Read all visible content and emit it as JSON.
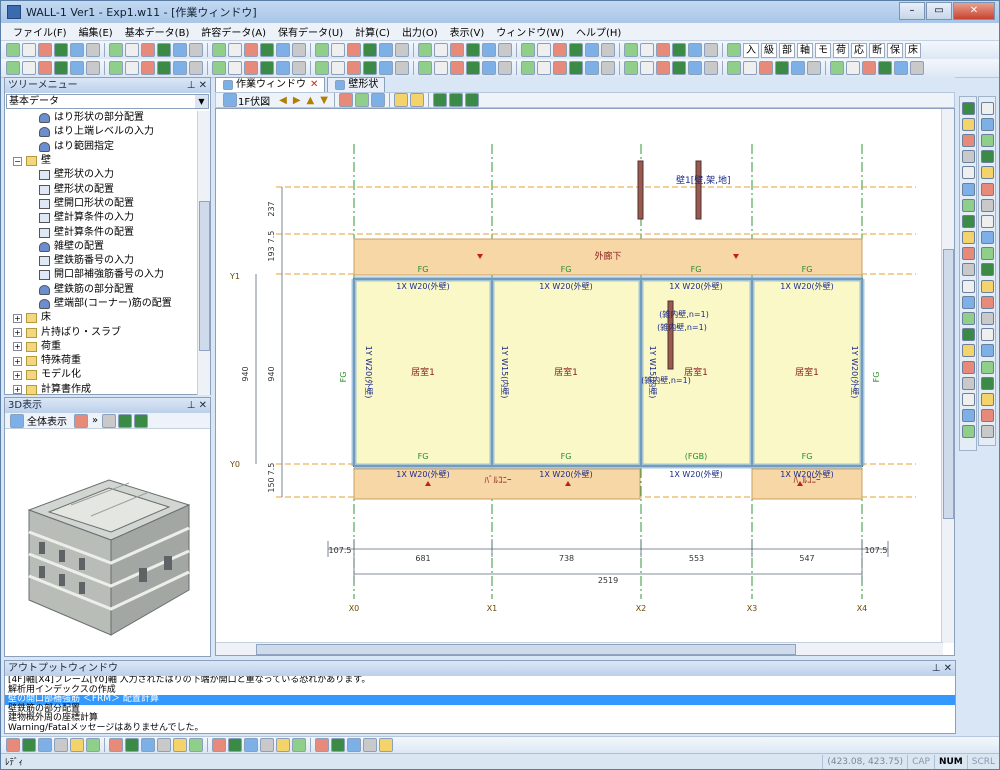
{
  "window": {
    "title": "WALL-1 Ver1 - Exp1.w11 - [作業ウィンドウ]",
    "min": "–",
    "max": "▭",
    "close": "✕"
  },
  "menu": [
    "ファイル(F)",
    "編集(E)",
    "基本データ(B)",
    "許容データ(A)",
    "保有データ(U)",
    "計算(C)",
    "出力(O)",
    "表示(V)",
    "ウィンドウ(W)",
    "ヘルプ(H)"
  ],
  "toolbar_text": [
    "入",
    "級",
    "部",
    "軸",
    "モ",
    "荷",
    "応",
    "断",
    "保",
    "床"
  ],
  "tree": {
    "header": "ツリーメニュー",
    "combo": "基本データ",
    "items": [
      {
        "label": "はり形状の部分配置",
        "icon": "leaf",
        "indent": 2
      },
      {
        "label": "はり上端レベルの入力",
        "icon": "leaf",
        "indent": 2
      },
      {
        "label": "はり範囲指定",
        "icon": "leaf",
        "indent": 2
      },
      {
        "label": "壁",
        "icon": "folder",
        "indent": 0,
        "exp": "−"
      },
      {
        "label": "壁形状の入力",
        "icon": "doc",
        "indent": 2
      },
      {
        "label": "壁形状の配置",
        "icon": "doc",
        "indent": 2
      },
      {
        "label": "壁開口形状の配置",
        "icon": "doc",
        "indent": 2
      },
      {
        "label": "壁計算条件の入力",
        "icon": "doc",
        "indent": 2
      },
      {
        "label": "壁計算条件の配置",
        "icon": "doc",
        "indent": 2
      },
      {
        "label": "雑壁の配置",
        "icon": "leaf",
        "indent": 2
      },
      {
        "label": "壁鉄筋番号の入力",
        "icon": "doc",
        "indent": 2
      },
      {
        "label": "開口部補強筋番号の入力",
        "icon": "doc",
        "indent": 2
      },
      {
        "label": "壁鉄筋の部分配置",
        "icon": "leaf",
        "indent": 2
      },
      {
        "label": "壁端部(コーナー)筋の配置",
        "icon": "leaf",
        "indent": 2
      },
      {
        "label": "床",
        "icon": "folder",
        "indent": 0,
        "exp": "+"
      },
      {
        "label": "片持ばり・スラブ",
        "icon": "folder",
        "indent": 0,
        "exp": "+"
      },
      {
        "label": "荷重",
        "icon": "folder",
        "indent": 0,
        "exp": "+"
      },
      {
        "label": "特殊荷重",
        "icon": "folder",
        "indent": 0,
        "exp": "+"
      },
      {
        "label": "モデル化",
        "icon": "folder",
        "indent": 0,
        "exp": "+"
      },
      {
        "label": "計算書作成",
        "icon": "folder",
        "indent": 0,
        "exp": "+"
      }
    ]
  },
  "view3d": {
    "header": "3D表示",
    "fit_label": "全体表示"
  },
  "tabs": [
    {
      "label": "作業ウィンドウ",
      "close": "✕"
    },
    {
      "label": "壁形状",
      "close": ""
    }
  ],
  "drawbar": {
    "floor_label": "1F伏図"
  },
  "plan": {
    "corridor": "外廊下",
    "balcony_left": "ﾊﾞﾙｺﾆｰ",
    "balcony_right": "ﾊﾞﾙｺﾆｰ",
    "room": "居室1",
    "frame_label": "FG",
    "frame_label_b": "(FGB)",
    "wall_top": "1X W20(外壁)",
    "wall_bot": "1X W20(外壁)",
    "wall_side": "1Y W20(外壁)",
    "wall_inner": "1Y W15(内壁)",
    "zatsu": "(雑内壁,n=1)",
    "leader": "壁1[壁,架,地]",
    "col_axes": [
      "X0",
      "X1",
      "X2",
      "X3",
      "X4"
    ],
    "row_axes": [
      "Y0",
      "Y1"
    ],
    "spans": [
      "681",
      "738",
      "553",
      "547"
    ],
    "total": "2519",
    "overhang_l": "107.5",
    "overhang_r": "107.5",
    "vdims": [
      "237",
      "7.5",
      "193",
      "940",
      "7.5",
      "150"
    ],
    "vdim_inner": "940"
  },
  "output": {
    "header": "アウトプットウィンドウ",
    "lines": [
      "[4F]軸[X4]フレーム[Y0]軸 入力されたはりの下端が開口と重なっている恐れがあります。",
      "解析用インデックスの作成",
      "壁の開口部補強筋 ＜FRM＞ 配置計算",
      "壁鉄筋の部分配置",
      "建物概外周の座標計算",
      "Warning/Fatalメッセージはありませんでした。"
    ],
    "selected": 2
  },
  "status": {
    "ready": "ﾚﾃﾞｨ",
    "coords": "(423.08, 423.75)",
    "cap": "CAP",
    "num": "NUM",
    "scrl": "SCRL"
  }
}
